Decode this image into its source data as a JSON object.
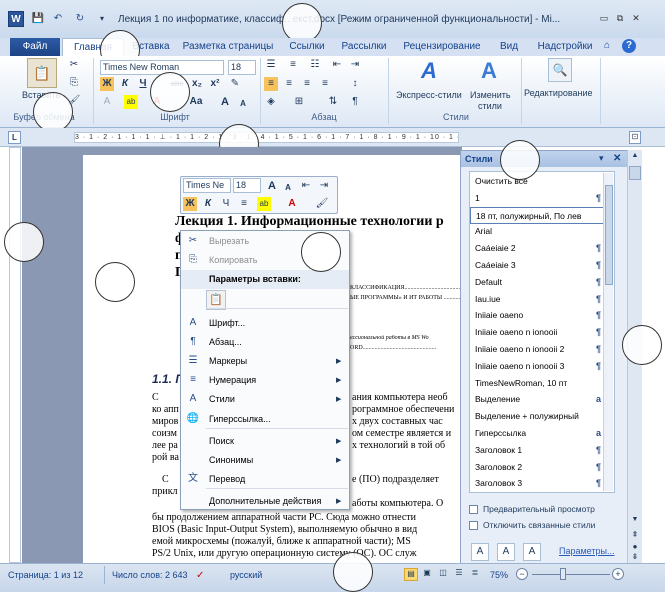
{
  "window": {
    "title": "Лекция 1 по информатике, классиф...екст.docx [Режим ограниченной функциональности] - Mi...",
    "app_icon": "W"
  },
  "qat": {
    "save_icon": "save-icon",
    "undo_icon": "undo-icon",
    "redo_icon": "redo-icon"
  },
  "tabs": [
    "Файл",
    "Главная",
    "Вставка",
    "Разметка страницы",
    "Ссылки",
    "Рассылки",
    "Рецензирование",
    "Вид",
    "Надстройки"
  ],
  "ribbon": {
    "clipboard": {
      "paste_label": "Вставить",
      "group": "Буфер обмена"
    },
    "font": {
      "name": "Times New Roman",
      "size": "18",
      "group": "Шрифт",
      "bold": "Ж",
      "italic": "К",
      "underline": "Ч",
      "strike": "abc",
      "sub": "x₂",
      "sup": "x²",
      "grow": "A",
      "shrink": "A",
      "case": "Aa"
    },
    "paragraph": {
      "group": "Абзац"
    },
    "styles": {
      "express_label": "Экспресс-стили",
      "change_label": "Изменить стили",
      "group": "Стили"
    },
    "editing": {
      "label": "Редактирование"
    }
  },
  "ruler": {
    "marks": "3 · 1 · 2 · 1 · 1 · 1 · ⊥ · 1 · 1 · 2 · 1 · 3 · 1 · 4 · 1 · 5 · 1 · 6 · 1 · 7 · 1 · 8 · 1 · 9 · 1 · 10 · 1 · 11 · 1 · 12 · 1 · 13 · 1 · 14 · 1 · 15 · △ 16 · 1 · 17"
  },
  "minitoolbar": {
    "font": "Times Ne",
    "size": "18"
  },
  "document": {
    "heading_line1": "Лекция 1. Информационные технологии р",
    "heading_line2": "ф                        классификация и",
    "heading_line3": "п",
    "heading_line4": "П",
    "toc_line1": "КЛАССИФИКАЦИЯ.........................................",
    "toc_line2": "ЫЕ ПРОГРАММЫ» И ИТ РАБОТЫ .........................",
    "toc_line3": "ессиональной работы в MS Wo",
    "toc_line4": "ORD.................................................",
    "section_title": "1.1. П                              е. Понятие. Клас",
    "p1": "ания компьютера необ",
    "p2": "рограммное обеспечени",
    "p3": "х двух составных час",
    "p4": "ом семестре является и",
    "p5": "х технологий в той об",
    "p6": "е (ПО) подразделяет",
    "line_ko": "ко апп",
    "line_mir": "миров",
    "line_soi": "соизм",
    "line_lee": "лее ра",
    "line_roy": "рой ва",
    "line_c": "С",
    "line_prikl": "прикл",
    "line_os": "аботы компьютера. О",
    "l1": "бы продолжением аппаратной части PC. Сюда можно отнести",
    "l2": "BIOS (Basic Input-Output System), выполняемую обычно в вид",
    "l3": "емой микросхемы (пожалуй, ближе к аппаратной части); MS",
    "l4": "PS/2 Unix, или другую операционную систему (ОС). ОС служ"
  },
  "context_menu": [
    {
      "label": "Вырезать",
      "disabled": true,
      "icon": "scissors-icon"
    },
    {
      "label": "Копировать",
      "disabled": true,
      "icon": "copy-icon"
    },
    {
      "label": "Параметры вставки:",
      "disabled": false,
      "icon": "",
      "header": true
    },
    {
      "label": "Шрифт...",
      "disabled": false,
      "icon": "font-icon"
    },
    {
      "label": "Абзац...",
      "disabled": false,
      "icon": "paragraph-icon"
    },
    {
      "label": "Маркеры",
      "disabled": false,
      "icon": "bullets-icon",
      "sub": true
    },
    {
      "label": "Нумерация",
      "disabled": false,
      "icon": "numbering-icon",
      "sub": true
    },
    {
      "label": "Стили",
      "disabled": false,
      "icon": "styles-icon",
      "sub": true
    },
    {
      "label": "Гиперссылка...",
      "disabled": false,
      "icon": "hyperlink-icon"
    },
    {
      "label": "Поиск",
      "disabled": false,
      "icon": "",
      "sub": true
    },
    {
      "label": "Синонимы",
      "disabled": false,
      "icon": "",
      "sub": true
    },
    {
      "label": "Перевод",
      "disabled": false,
      "icon": "translate-icon"
    },
    {
      "label": "Дополнительные действия",
      "disabled": false,
      "icon": "",
      "sub": true
    }
  ],
  "styles_pane": {
    "title": "Стили",
    "items": [
      {
        "label": "Очистить все",
        "mark": ""
      },
      {
        "label": "1",
        "mark": "¶"
      },
      {
        "label": "18 пт, полужирный, По лев",
        "mark": "",
        "selected": true
      },
      {
        "label": "Arial",
        "mark": ""
      },
      {
        "label": "Caáeiaie 2",
        "mark": "¶"
      },
      {
        "label": "Caáeiaie 3",
        "mark": "¶"
      },
      {
        "label": "Default",
        "mark": "¶"
      },
      {
        "label": "Iau.iue",
        "mark": "¶"
      },
      {
        "label": "Iniiaie oaeno",
        "mark": "¶"
      },
      {
        "label": "Iniiaie oaeno n ionooii",
        "mark": "¶"
      },
      {
        "label": "Iniiaie oaeno n ionooii 2",
        "mark": "¶"
      },
      {
        "label": "Iniiaie oaeno n ionooii 3",
        "mark": "¶"
      },
      {
        "label": "TimesNewRoman, 10 пт",
        "mark": ""
      },
      {
        "label": "Выделение",
        "mark": "a"
      },
      {
        "label": "Выделение + полужирный",
        "mark": ""
      },
      {
        "label": "Гиперссылка",
        "mark": "a"
      },
      {
        "label": "Заголовок 1",
        "mark": "¶"
      },
      {
        "label": "Заголовок 2",
        "mark": "¶"
      },
      {
        "label": "Заголовок 3",
        "mark": "¶"
      }
    ],
    "preview_label": "Предварительный просмотр",
    "linked_label": "Отключить связанные стили",
    "params_label": "Параметры..."
  },
  "status": {
    "page": "Страница: 1 из 12",
    "words": "Число слов: 2 643",
    "lang": "русский",
    "zoom": "75%"
  }
}
